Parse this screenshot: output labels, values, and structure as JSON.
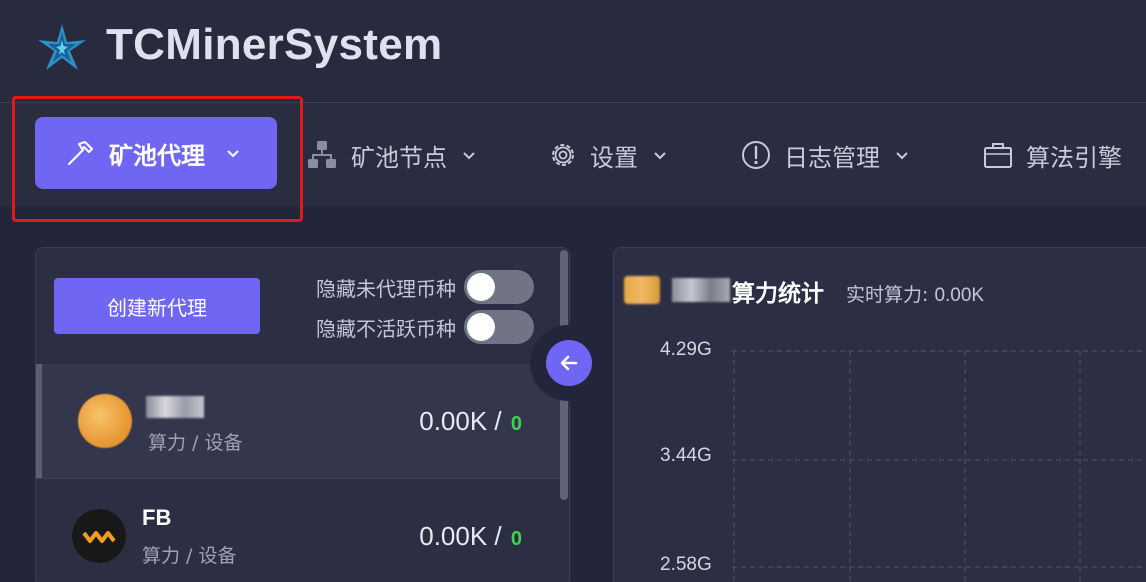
{
  "header": {
    "title": "TCMinerSystem",
    "logo_icon": "star-logo-icon"
  },
  "nav": {
    "items": [
      {
        "label": "矿池代理",
        "icon": "hammer-icon",
        "active": true
      },
      {
        "label": "矿池节点",
        "icon": "network-nodes-icon"
      },
      {
        "label": "设置",
        "icon": "gear-icon"
      },
      {
        "label": "日志管理",
        "icon": "exclamation-circle-icon"
      },
      {
        "label": "算法引擎",
        "icon": "briefcase-icon"
      }
    ],
    "highlight_color": "#e3191b"
  },
  "proxy_panel": {
    "create_button": "创建新代理",
    "toggles": [
      {
        "label": "隐藏未代理币种",
        "on": false
      },
      {
        "label": "隐藏不活跃币种",
        "on": false
      }
    ],
    "coins": [
      {
        "name": "",
        "sub": "算力 / 设备",
        "hashrate": "0.00K /",
        "devices": "0",
        "icon": "blurred-coin-icon",
        "active": true
      },
      {
        "name": "FB",
        "sub": "算力 / 设备",
        "hashrate": "0.00K /",
        "devices": "0",
        "icon": "fb-coin-icon",
        "active": false
      }
    ],
    "collapse_icon": "arrow-left-icon"
  },
  "chart_panel": {
    "title": "算力统计",
    "realtime_label": "实时算力:",
    "realtime_value": "0.00K"
  },
  "chart_data": {
    "type": "line",
    "title": "算力统计",
    "y_ticks": [
      "4.29G",
      "3.44G",
      "2.58G"
    ],
    "grid": true,
    "grid_style": "dashed",
    "series": []
  },
  "colors": {
    "accent": "#6f66f4",
    "background": "#23263a",
    "panel": "#2c2f44",
    "device_count": "#3ed34c"
  }
}
